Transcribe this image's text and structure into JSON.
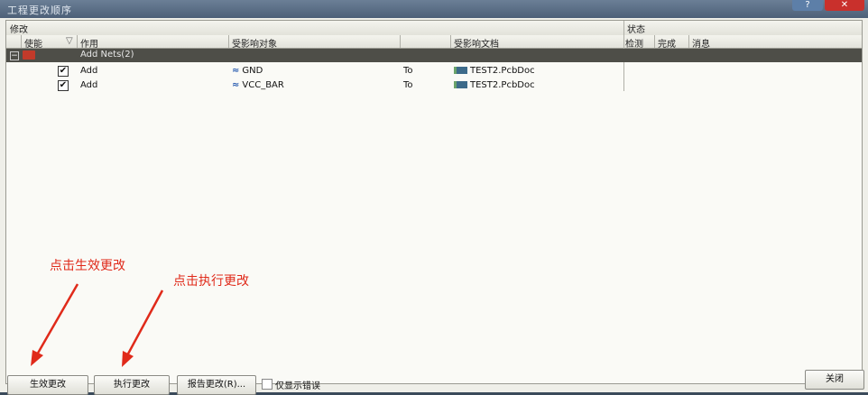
{
  "window": {
    "title": "工程更改顺序"
  },
  "headers": {
    "group_modify": "修改",
    "group_status": "状态",
    "enable": "使能",
    "action": "作用",
    "affected_object": "受影响对象",
    "affected_doc": "受影响文档",
    "check": "检测",
    "done": "完成",
    "message": "消息"
  },
  "group": {
    "label": "Add Nets(2)"
  },
  "rows": [
    {
      "checked": "✔",
      "action": "Add",
      "object": "GND",
      "to": "To",
      "document": "TEST2.PcbDoc"
    },
    {
      "checked": "✔",
      "action": "Add",
      "object": "VCC_BAR",
      "to": "To",
      "document": "TEST2.PcbDoc"
    }
  ],
  "buttons": {
    "validate": "生效更改",
    "execute": "执行更改",
    "report": "报告更改(R)...",
    "only_errors": "仅显示错误",
    "close": "关闭"
  },
  "annotations": {
    "validate_hint": "点击生效更改",
    "execute_hint": "点击执行更改"
  },
  "colors": {
    "annotation": "#e02a1a",
    "close_button": "#c9302c",
    "group_row": "#4e4e48"
  }
}
